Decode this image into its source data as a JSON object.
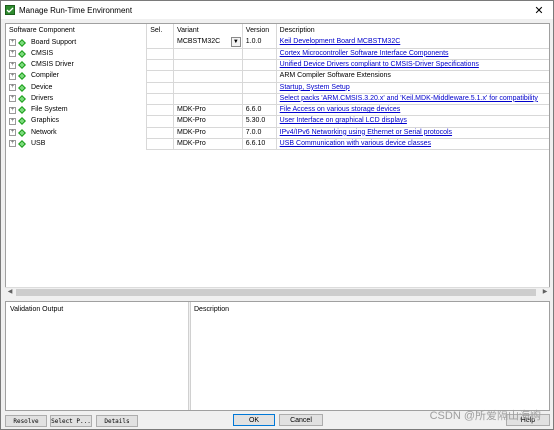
{
  "window": {
    "title": "Manage Run-Time Environment",
    "close_glyph": "✕",
    "colors": {
      "link": "#0000cc",
      "gem": "#1a9e1a",
      "accent": "#0078d7"
    }
  },
  "grid": {
    "headers": {
      "component": "Software Component",
      "sel": "Sel.",
      "variant": "Variant",
      "version": "Version",
      "description": "Description"
    },
    "rows": [
      {
        "name": "Board Support",
        "sel": "",
        "variant": "MCBSTM32C",
        "version": "1.0.0",
        "description": "Keil Development Board MCBSTM32C",
        "link": true,
        "dropdown": true
      },
      {
        "name": "CMSIS",
        "sel": "",
        "variant": "",
        "version": "",
        "description": "Cortex Microcontroller Software Interface Components",
        "link": true
      },
      {
        "name": "CMSIS Driver",
        "sel": "",
        "variant": "",
        "version": "",
        "description": "Unified Device Drivers compliant to CMSIS-Driver Specifications",
        "link": true
      },
      {
        "name": "Compiler",
        "sel": "",
        "variant": "",
        "version": "",
        "description": "ARM Compiler Software Extensions",
        "link": false
      },
      {
        "name": "Device",
        "sel": "",
        "variant": "",
        "version": "",
        "description": "Startup, System Setup",
        "link": true
      },
      {
        "name": "Drivers",
        "sel": "",
        "variant": "",
        "version": "",
        "description": "Select packs 'ARM.CMSIS.3.20.x' and 'Keil.MDK-Middleware.5.1.x' for compatibility",
        "link": true
      },
      {
        "name": "File System",
        "sel": "",
        "variant": "MDK-Pro",
        "version": "6.6.0",
        "description": "File Access on various storage devices",
        "link": true
      },
      {
        "name": "Graphics",
        "sel": "",
        "variant": "MDK-Pro",
        "version": "5.30.0",
        "description": "User Interface on graphical LCD displays",
        "link": true
      },
      {
        "name": "Network",
        "sel": "",
        "variant": "MDK-Pro",
        "version": "7.0.0",
        "description": "IPv4/IPv6 Networking using Ethernet or Serial protocols",
        "link": true
      },
      {
        "name": "USB",
        "sel": "",
        "variant": "MDK-Pro",
        "version": "6.6.10",
        "description": "USB Communication with various device classes",
        "link": true
      }
    ]
  },
  "panels": {
    "validation": "Validation Output",
    "description": "Description"
  },
  "buttons": {
    "resolve": "Resolve",
    "select_packs": "Select P...",
    "details": "Details",
    "ok": "OK",
    "cancel": "Cancel",
    "help": "Help"
  },
  "watermark": "CSDN @所爱隔山海购"
}
